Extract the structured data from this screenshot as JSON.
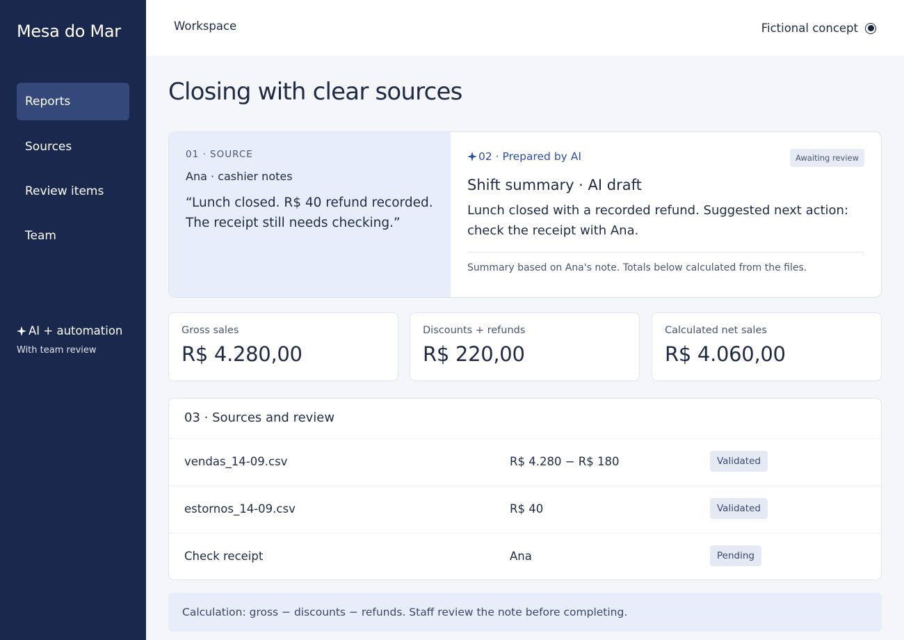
{
  "app": {
    "name": "Mesa do Mar"
  },
  "sidebar": {
    "items": [
      {
        "label": "Reports",
        "active": true
      },
      {
        "label": "Sources",
        "active": false
      },
      {
        "label": "Review items",
        "active": false
      },
      {
        "label": "Team",
        "active": false
      }
    ],
    "ai": {
      "icon": "sparkle-icon",
      "title": "AI + automation",
      "subtitle": "With team review"
    }
  },
  "topbar": {
    "title": "Workspace",
    "concept_label": "Fictional concept",
    "concept_icon": "radio-selected-icon"
  },
  "page": {
    "title": "Closing with clear sources"
  },
  "source_panel": {
    "kicker": "01 · SOURCE",
    "author": "Ana · cashier notes",
    "quote": "“Lunch closed. R$ 40 refund recorded. The receipt still needs checking.”"
  },
  "ai_panel": {
    "icon": "sparkle-icon",
    "kicker": "02 · Prepared by AI",
    "badge": "Awaiting review",
    "title": "Shift summary · AI draft",
    "body": "Lunch closed with a recorded refund. Suggested next action: check the receipt with Ana.",
    "note": "Summary based on Ana's note. Totals below calculated from the files."
  },
  "metrics": [
    {
      "label": "Gross sales",
      "value": "R$ 4.280,00"
    },
    {
      "label": "Discounts + refunds",
      "value": "R$ 220,00"
    },
    {
      "label": "Calculated net sales",
      "value": "R$ 4.060,00"
    }
  ],
  "sources_table": {
    "title": "03 · Sources and review",
    "rows": [
      {
        "file": "vendas_14-09.csv",
        "value": "R$ 4.280 − R$ 180",
        "status": "Validated"
      },
      {
        "file": "estornos_14-09.csv",
        "value": "R$ 40",
        "status": "Validated"
      },
      {
        "file": "Check receipt",
        "value": "Ana",
        "status": "Pending"
      }
    ]
  },
  "footer": {
    "note": "Calculation: gross − discounts − refunds. Staff review the note before completing."
  },
  "colors": {
    "sidebar_bg": "#1a284d",
    "active_nav": "#34497a",
    "ai_accent": "#2f4ca8",
    "source_bg": "#e8eef9",
    "badge_bg": "#e4e9f3"
  }
}
